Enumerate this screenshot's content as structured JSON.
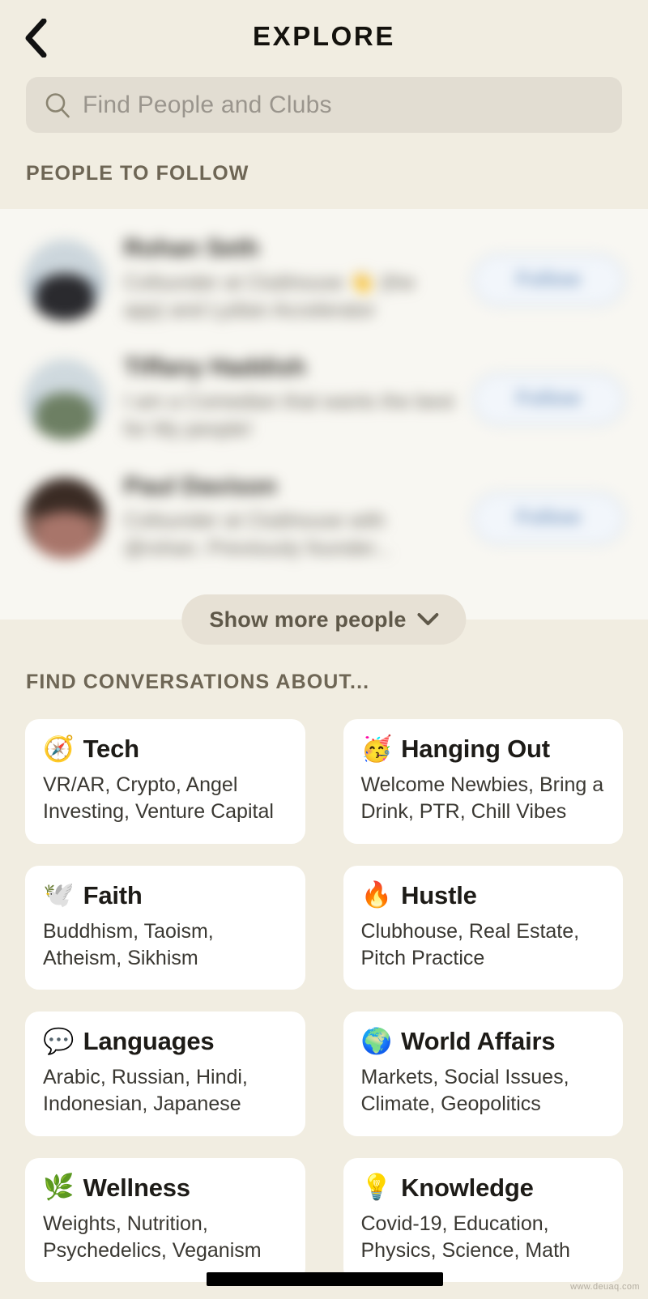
{
  "header": {
    "title": "EXPLORE",
    "back_icon": "chevron-left-icon"
  },
  "search": {
    "icon": "search-icon",
    "placeholder": "Find People and Clubs",
    "value": ""
  },
  "people_section": {
    "title": "PEOPLE TO FOLLOW",
    "people": [
      {
        "name": "Rohan Seth",
        "bio": "Cofounder at Clubhouse 👋 (the app) and Lydian Accelerator",
        "follow_label": "Follow"
      },
      {
        "name": "Tiffany Haddish",
        "bio": "I am a Comedian that wants the best for My people!",
        "follow_label": "Follow"
      },
      {
        "name": "Paul Davison",
        "bio": "Cofounder at Clubhouse with @rohan. Previously founder...",
        "follow_label": "Follow"
      }
    ],
    "show_more_label": "Show more people",
    "show_more_icon": "chevron-down-icon"
  },
  "topics_section": {
    "title": "FIND CONVERSATIONS ABOUT...",
    "topics": [
      {
        "emoji": "🧭",
        "icon_name": "compass-emoji",
        "name": "Tech",
        "desc": "VR/AR, Crypto, Angel Investing, Venture Capital"
      },
      {
        "emoji": "🥳",
        "icon_name": "partying-face-emoji",
        "name": "Hanging Out",
        "desc": "Welcome Newbies, Bring a Drink, PTR, Chill Vibes"
      },
      {
        "emoji": "🕊️",
        "icon_name": "dove-emoji",
        "name": "Faith",
        "desc": "Buddhism, Taoism, Atheism, Sikhism"
      },
      {
        "emoji": "🔥",
        "icon_name": "fire-emoji",
        "name": "Hustle",
        "desc": "Clubhouse, Real Estate, Pitch Practice"
      },
      {
        "emoji": "💬",
        "icon_name": "speech-balloon-emoji",
        "name": "Languages",
        "desc": "Arabic, Russian, Hindi, Indonesian, Japanese"
      },
      {
        "emoji": "🌍",
        "icon_name": "globe-europe-africa-emoji",
        "name": "World Affairs",
        "desc": "Markets, Social Issues, Climate, Geopolitics"
      },
      {
        "emoji": "🌿",
        "icon_name": "herb-emoji",
        "name": "Wellness",
        "desc": "Weights, Nutrition, Psychedelics, Veganism"
      },
      {
        "emoji": "💡",
        "icon_name": "light-bulb-emoji",
        "name": "Knowledge",
        "desc": "Covid-19, Education, Physics, Science, Math"
      }
    ]
  },
  "overlay": {
    "watermark": "www.deuaq.com"
  },
  "colors": {
    "page_background": "#f1ede1",
    "panel_background": "#f8f7f2",
    "card_background": "#ffffff",
    "search_background": "#e2ddd2",
    "section_title": "#6e6655",
    "follow_accent": "#7d9dc4",
    "pill_background": "#e7e1d5"
  }
}
